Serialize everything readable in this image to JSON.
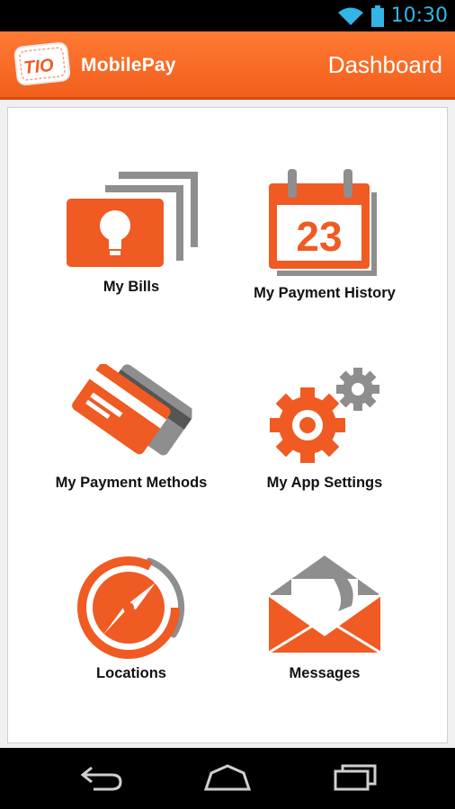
{
  "status_bar": {
    "time": "10:30"
  },
  "app_bar": {
    "logo_text": "TIO",
    "app_name": "MobilePay",
    "title": "Dashboard"
  },
  "tiles": [
    {
      "label": "My Bills",
      "icon": "bills-icon"
    },
    {
      "label": "My Payment History",
      "icon": "calendar-icon",
      "calendar_day": "23"
    },
    {
      "label": "My Payment Methods",
      "icon": "credit-card-icon"
    },
    {
      "label": "My App Settings",
      "icon": "gears-icon"
    },
    {
      "label": "Locations",
      "icon": "compass-icon"
    },
    {
      "label": "Messages",
      "icon": "envelope-icon"
    }
  ],
  "nav_bar": {
    "icons": [
      "back-icon",
      "home-icon",
      "recent-apps-icon"
    ]
  },
  "colors": {
    "accent": "#f25f1c",
    "icon_orange": "#f05a23",
    "icon_gray": "#8e8e8e",
    "status_clock": "#33b5e5"
  }
}
